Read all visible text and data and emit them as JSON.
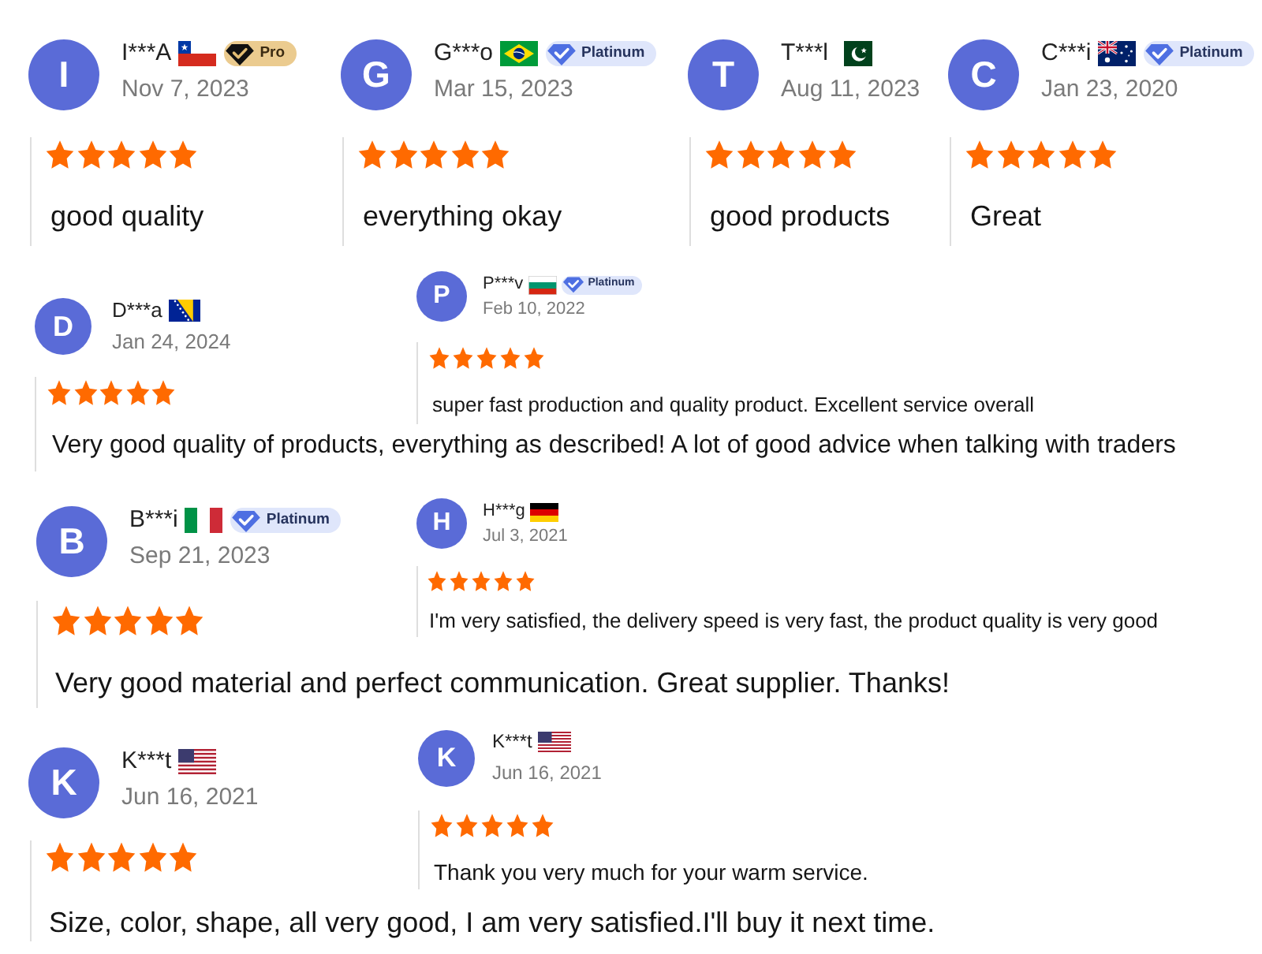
{
  "review_rows": [
    {
      "kind": "strip",
      "reviews": [
        {
          "avatar": "I",
          "name": "I***A",
          "flag": {
            "kind": "chile"
          },
          "badge": {
            "kind": "pro",
            "label": "Pro"
          },
          "date": "Nov 7, 2023",
          "stars": 5,
          "text": "good quality"
        },
        {
          "avatar": "G",
          "name": "G***o",
          "flag": {
            "kind": "brazil"
          },
          "badge": {
            "kind": "platinum",
            "label": "Platinum"
          },
          "date": "Mar 15, 2023",
          "stars": 5,
          "text": "everything okay"
        },
        {
          "avatar": "T",
          "name": "T***l",
          "flag": {
            "kind": "pakistan"
          },
          "date": "Aug 11, 2023",
          "stars": 5,
          "text": "good products"
        },
        {
          "avatar": "C",
          "name": "C***i",
          "flag": {
            "kind": "australia"
          },
          "badge": {
            "kind": "platinum",
            "label": "Platinum"
          },
          "date": "Jan 23, 2020",
          "stars": 5,
          "text": "Great"
        }
      ]
    },
    {
      "kind": "pair",
      "main": {
        "avatar": "D",
        "name": "D***a",
        "flag": {
          "kind": "bosnia"
        },
        "date": "Jan 24, 2024",
        "stars": 5,
        "text": "Very good quality of products, everything as described! A lot of good advice when talking with traders"
      },
      "side": {
        "avatar": "P",
        "name": "P***v",
        "flag": {
          "kind": "bulgaria"
        },
        "badge": {
          "kind": "platinum",
          "label": "Platinum"
        },
        "date": "Feb 10, 2022",
        "stars": 5,
        "text": "super fast production and quality product. Excellent service overall"
      }
    },
    {
      "kind": "pair",
      "main": {
        "avatar": "B",
        "name": "B***i",
        "flag": {
          "kind": "italy"
        },
        "badge": {
          "kind": "platinum",
          "label": "Platinum"
        },
        "date": "Sep 21, 2023",
        "stars": 5,
        "text": "Very good material and perfect communication. Great supplier. Thanks!"
      },
      "side": {
        "avatar": "H",
        "name": "H***g",
        "flag": {
          "kind": "germany"
        },
        "date": "Jul 3, 2021",
        "stars": 5,
        "text": "I'm very satisfied, the delivery speed is very fast, the product quality is very good"
      }
    },
    {
      "kind": "pair",
      "main": {
        "avatar": "K",
        "name": "K***t",
        "flag": {
          "kind": "usa"
        },
        "date": "Jun 16, 2021",
        "stars": 5,
        "text": "Size, color, shape, all very good, I am very satisfied.I'll buy it next time."
      },
      "side": {
        "avatar": "K",
        "name": "K***t",
        "flag": {
          "kind": "usa"
        },
        "date": "Jun 16, 2021",
        "stars": 5,
        "text": "Thank you very much for your warm service."
      }
    }
  ]
}
